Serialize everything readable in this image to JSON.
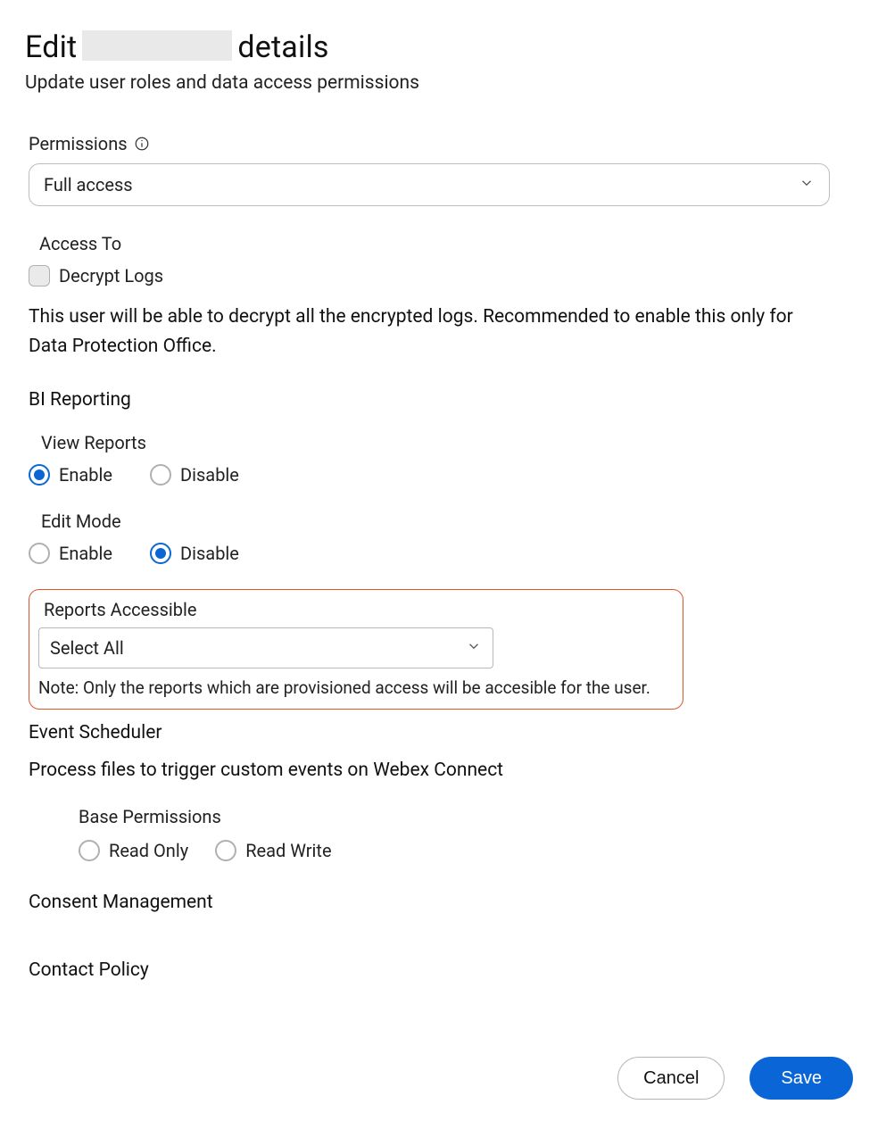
{
  "header": {
    "title_prefix": "Edit",
    "title_suffix": "details",
    "subtitle": "Update user roles and data access permissions"
  },
  "permissions": {
    "label": "Permissions",
    "selected": "Full access"
  },
  "access_to": {
    "label": "Access To",
    "decrypt_logs": {
      "label": "Decrypt Logs",
      "checked": false,
      "help": "This user will be able to decrypt all the encrypted logs. Recommended to enable this only for Data Protection Office."
    }
  },
  "bi_reporting": {
    "title": "BI Reporting",
    "view_reports": {
      "label": "View Reports",
      "enable_label": "Enable",
      "disable_label": "Disable",
      "value": "Enable"
    },
    "edit_mode": {
      "label": "Edit Mode",
      "enable_label": "Enable",
      "disable_label": "Disable",
      "value": "Disable"
    },
    "reports_accessible": {
      "label": "Reports Accessible",
      "selected": "Select All",
      "note": "Note: Only the reports which are provisioned access will be accesible for the user."
    }
  },
  "event_scheduler": {
    "title": "Event Scheduler",
    "description": "Process files to trigger custom events on Webex Connect",
    "base_permissions": {
      "label": "Base Permissions",
      "read_only_label": "Read Only",
      "read_write_label": "Read Write",
      "value": null
    }
  },
  "consent_management": {
    "title": "Consent Management"
  },
  "contact_policy": {
    "title": "Contact Policy"
  },
  "footer": {
    "cancel": "Cancel",
    "save": "Save"
  },
  "colors": {
    "accent": "#0a66d6",
    "highlight_border": "#e0532f"
  }
}
